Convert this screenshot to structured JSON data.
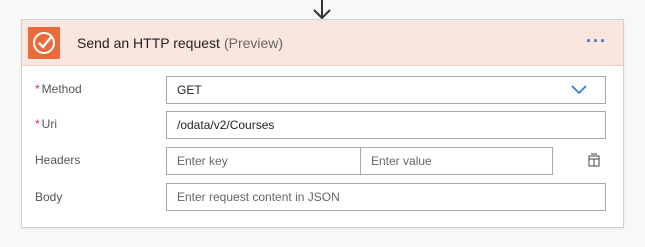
{
  "header": {
    "title": "Send an HTTP request",
    "badge": "(Preview)",
    "more_glyph": "···",
    "icon": "http-request-icon",
    "accent_color": "#eb6a3b"
  },
  "form": {
    "method": {
      "label": "Method",
      "required_mark": "*",
      "value": "GET"
    },
    "uri": {
      "label": "Uri",
      "required_mark": "*",
      "value": "/odata/v2/Courses"
    },
    "headers": {
      "label": "Headers",
      "key_placeholder": "Enter key",
      "value_placeholder": "Enter value"
    },
    "body": {
      "label": "Body",
      "placeholder": "Enter request content in JSON"
    }
  }
}
